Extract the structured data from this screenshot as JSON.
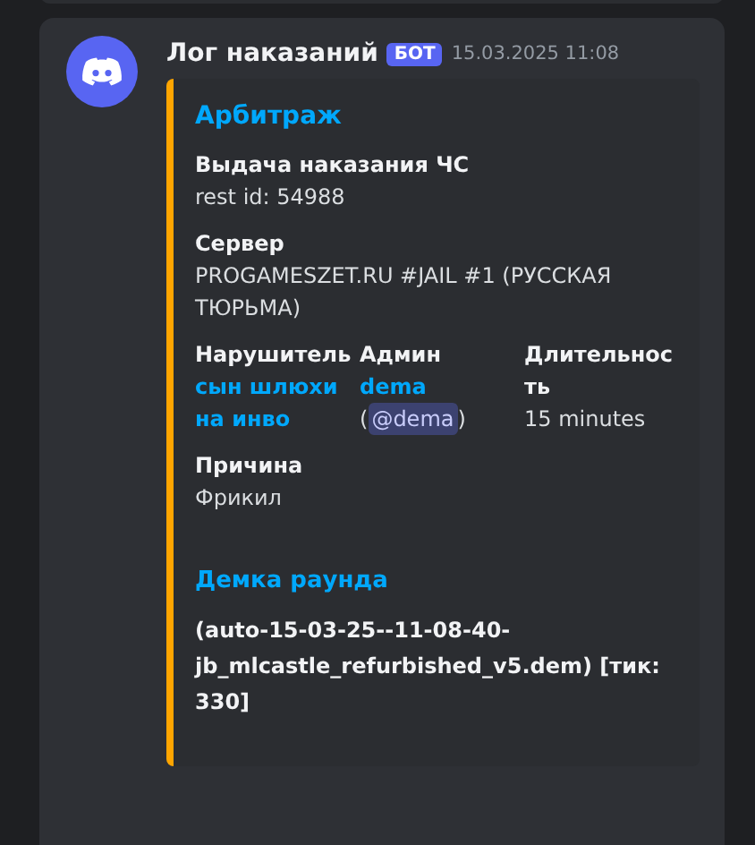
{
  "message": {
    "author": "Лог наказаний",
    "badge": "БОТ",
    "timestamp": "15.03.2025 11:08"
  },
  "embed": {
    "color": "#ffa500",
    "title": "Арбитраж",
    "fields": [
      {
        "name": "Выдача наказания ЧС",
        "value": "rest id: 54988",
        "kind": "text",
        "inline": false
      },
      {
        "name": "Сервер",
        "value": "PROGAMESZET.RU #JAIL #1 (РУССКАЯ ТЮРЬМА)",
        "kind": "text",
        "inline": false
      },
      {
        "name": "Нарушитель",
        "value": "сын шлюхи на инво",
        "kind": "link",
        "inline": true
      },
      {
        "name": "Админ",
        "value": "dema",
        "kind": "link",
        "mention_open": "(",
        "mention": "@dema",
        "mention_close": ")",
        "inline": true
      },
      {
        "name": "Длительность",
        "value": "15 minutes",
        "kind": "text",
        "inline": true
      },
      {
        "name": "Причина",
        "value": "Фрикил",
        "kind": "text",
        "inline": false
      }
    ],
    "link_title": "Демка раунда",
    "description": "(auto-15-03-25--11-08-40-jb_mlcastle_refurbished_v5.dem) [тик: 330]"
  }
}
